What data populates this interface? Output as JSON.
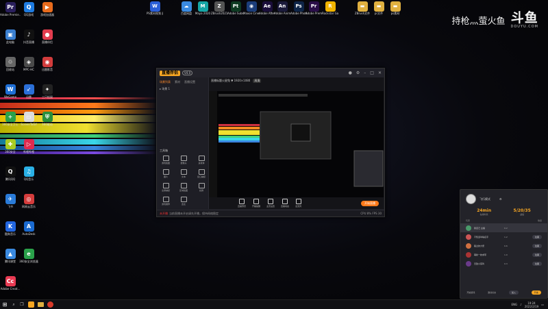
{
  "watermark": {
    "text": "持枪灬萤火鱼",
    "logo": "斗鱼",
    "logo_sub": "DOUYU.COM"
  },
  "desktop_icons_left": [
    {
      "label": "Adobe Premie...",
      "color": "#2a1f5c",
      "glyph": "Pr"
    },
    {
      "label": "QQ游戏",
      "color": "#1e7be0",
      "glyph": "Q"
    },
    {
      "label": "游戏加速器",
      "color": "#e86b1c",
      "glyph": "▶"
    },
    {
      "label": "此电脑",
      "color": "#3a7fd0",
      "glyph": "▣"
    },
    {
      "label": "抖音直播",
      "color": "#111",
      "glyph": "♪"
    },
    {
      "label": "直播伴侣",
      "color": "#e33d4f",
      "glyph": "●"
    },
    {
      "label": "回收站",
      "color": "#666",
      "glyph": "♲"
    },
    {
      "label": "MPC-HC",
      "color": "#4a4a4a",
      "glyph": "◈"
    },
    {
      "label": "迅雷影音",
      "color": "#d23c3c",
      "glyph": "◉"
    },
    {
      "label": "WeGame",
      "color": "#1f6fd6",
      "glyph": "W"
    },
    {
      "label": "迅雷",
      "color": "#2b6fd8",
      "glyph": "➶"
    },
    {
      "label": "三只松鼠",
      "color": "#222",
      "glyph": "✦"
    },
    {
      "label": "360安全卫士",
      "color": "#2aa14a",
      "glyph": "+"
    },
    {
      "label": "ScreenToGif",
      "color": "#ddd",
      "glyph": "▭"
    },
    {
      "label": "360驱动",
      "color": "#2b8f3c",
      "glyph": "⛨"
    },
    {
      "label": "360安全",
      "color": "#aacc22",
      "glyph": "✚"
    },
    {
      "label": "哔哩哔哩",
      "color": "#e02a4f",
      "glyph": "▷"
    },
    {
      "label": "游戏",
      "color": "#7a4",
      "glyph": "◆"
    },
    {
      "label": "腾讯QQ",
      "color": "#111",
      "glyph": "Q"
    },
    {
      "label": "QQ音乐",
      "color": "#2ab0e6",
      "glyph": "♫"
    },
    {
      "label": "微信",
      "color": "#2cc05c",
      "glyph": "✉"
    },
    {
      "label": "飞书",
      "color": "#2a7bd8",
      "glyph": "✈"
    },
    {
      "label": "网易云音乐",
      "color": "#d43c3c",
      "glyph": "◎"
    },
    {
      "label": "百度网盘",
      "color": "#3a8ae0",
      "glyph": "☁"
    },
    {
      "label": "酷狗音乐",
      "color": "#2266e0",
      "glyph": "K"
    },
    {
      "label": "AutoDesk",
      "color": "#1a6ad0",
      "glyph": "A"
    },
    {
      "label": "微信",
      "color": "#2cc05c",
      "glyph": "✉"
    },
    {
      "label": "腾讯课堂",
      "color": "#3a8ae0",
      "glyph": "▲"
    },
    {
      "label": "360安全浏览器",
      "color": "#2aa14a",
      "glyph": "e"
    },
    {
      "label": "腾讯会议",
      "color": "#3b5fd8",
      "glyph": "◑"
    },
    {
      "label": "Adobe Creat...",
      "color": "#e83a52",
      "glyph": "Cc"
    }
  ],
  "desktop_icons_top": [
    {
      "label": "PS素材视频 展示.doc",
      "color": "#2a5ed6",
      "glyph": "W"
    },
    {
      "label": "百度网盘",
      "color": "#3a8ae0",
      "glyph": "☁"
    },
    {
      "label": "Maya 2020",
      "color": "#16a5a5",
      "glyph": "M"
    },
    {
      "label": "ZBrush2021",
      "color": "#555",
      "glyph": "Z"
    },
    {
      "label": "Adobe Substan...",
      "color": "#0e3a22",
      "glyph": "Pt"
    },
    {
      "label": "Maxon Cinema 4...",
      "color": "#1b3d7a",
      "glyph": "◉"
    },
    {
      "label": "Adobe After Effects 2020",
      "color": "#1a0e3a",
      "glyph": "Ae"
    },
    {
      "label": "Adobe Anima...",
      "color": "#1a1a3a",
      "glyph": "An"
    },
    {
      "label": "Adobe Photosh...",
      "color": "#0e2548",
      "glyph": "Ps"
    },
    {
      "label": "Adobe Premie...",
      "color": "#2a0e48",
      "glyph": "Pr"
    },
    {
      "label": "Rockstar Games...",
      "color": "#f0b400",
      "glyph": "R"
    },
    {
      "label": "ZBrush文件",
      "color": "#e0b040",
      "glyph": "▬"
    },
    {
      "label": "pr文件",
      "color": "#e0b040",
      "glyph": "▬"
    },
    {
      "label": "ps素材",
      "color": "#e0b040",
      "glyph": "▬"
    }
  ],
  "obs": {
    "logo": "直播伴侣",
    "version": "V4.0",
    "tabs": [
      "场景列表",
      "素材",
      "直播设置"
    ],
    "scene_name": "场景 1",
    "topinfo": "直播标题火星兔 ▼  1920×1080",
    "topinfo_pill": "高清",
    "tools_title": "工具箱",
    "tools": [
      "游戏截图",
      "摄像头",
      "多媒体",
      "图片",
      "文本",
      "窗口捕捉",
      "全屏捕捉",
      "区域截图",
      "投屏",
      "游戏推荐",
      "连麦"
    ],
    "bottom_buttons": [
      "直播预览",
      "开播提醒",
      "主页设置",
      "直播动态",
      "麦克风"
    ],
    "start_label": "开始直播",
    "status_left": "未开播",
    "status_text": "当前直播未开启请先开播，保持网络稳定",
    "status_right": "CPU 8%  FPS 30"
  },
  "panel": {
    "title": "飞行模式",
    "stat1_value": "24min",
    "stat1_label": "在线时长",
    "stat2_value": "5/20/35",
    "stat2_label": "战绩",
    "col1": "玩家",
    "col2": "等级",
    "rows": [
      {
        "name": "我自己 主播",
        "num": "0.2",
        "btn": ""
      },
      {
        "name": "不知道叫啥名字",
        "num": "1.2",
        "btn": "拉黑"
      },
      {
        "name": "路过的大佬",
        "num": "0.6",
        "btn": "拉黑"
      },
      {
        "name": "萌新一枚求带",
        "num": "1.0",
        "btn": "拉黑"
      },
      {
        "name": "无敌小菜鸡",
        "num": "0.3",
        "btn": "拉黑"
      }
    ],
    "foot1": "开始游戏",
    "foot2": "邀请好友",
    "foot3": "加入",
    "foot_action": "开播"
  },
  "taskbar": {
    "time": "19:24",
    "date": "2022/2/19",
    "tray_text": "ENG"
  }
}
